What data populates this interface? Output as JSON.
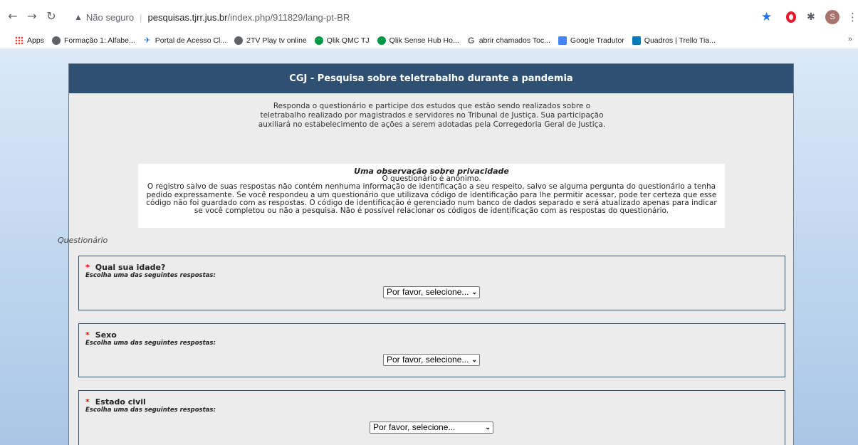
{
  "browser": {
    "security_label": "Não seguro",
    "url_domain": "pesquisas.tjrr.jus.br",
    "url_path": "/index.php/911829/lang-pt-BR",
    "profile_initial": "S"
  },
  "bookmarks": [
    {
      "label": "Apps",
      "icon": "apps-grid-icon"
    },
    {
      "label": "Formação 1: Alfabe...",
      "icon": "globe-icon"
    },
    {
      "label": "Portal de Acesso Cl...",
      "icon": "plane-icon"
    },
    {
      "label": "2TV Play tv online",
      "icon": "globe-icon"
    },
    {
      "label": "Qlik QMC TJ",
      "icon": "qlik-icon"
    },
    {
      "label": "Qlik Sense Hub Ho...",
      "icon": "qlik-icon"
    },
    {
      "label": "abrir chamados Toc...",
      "icon": "g-icon"
    },
    {
      "label": "Google Tradutor",
      "icon": "translate-icon"
    },
    {
      "label": "Quadros | Trello Tia...",
      "icon": "trello-icon"
    }
  ],
  "survey": {
    "title": "CGJ - Pesquisa sobre teletrabalho durante a pandemia",
    "intro_lines": [
      "Responda o questionário e participe dos estudos que estão sendo realizados sobre o",
      "teletrabalho realizado por magistrados e servidores no Tribunal de Justiça. Sua participação",
      "auxiliará no estabelecimento de ações a serem adotadas pela Corregedoria Geral de Justiça."
    ],
    "privacy": {
      "title": "Uma observação sobre privacidade",
      "subtitle": "O questionário é anônimo.",
      "lines": [
        "O registro salvo de suas respostas não contém nenhuma informação de identificação a seu respeito, salvo se alguma pergunta do questionário a tenha",
        "pedido expressamente. Se você respondeu a um questionário que utilizava código de identificação para lhe permitir acessar, pode ter certeza que esse",
        "código não foi guardado com as respostas. O código de identificação é gerenciado num banco de dados separado e será atualizado apenas para indicar",
        "se você completou ou não a pesquisa. Não é possível relacionar os códigos de identificação com as respostas do questionário."
      ]
    },
    "section_label": "Questionário",
    "questions": [
      {
        "required_mark": "*",
        "title": "Qual sua idade?",
        "help": "Escolha uma das seguintes respostas:",
        "select_value": "Por favor, selecione..."
      },
      {
        "required_mark": "*",
        "title": "Sexo",
        "help": "Escolha uma das seguintes respostas:",
        "select_value": "Por favor, selecione..."
      },
      {
        "required_mark": "*",
        "title": "Estado civil",
        "help": "Escolha uma das seguintes respostas:",
        "select_value": "Por favor, selecione..."
      }
    ]
  }
}
